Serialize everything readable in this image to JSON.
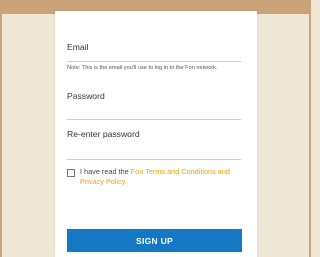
{
  "form": {
    "email_label": "Email",
    "email_note": "Note: This is the email you'll use to log in to the Fon network.",
    "password_label": "Password",
    "reenter_password_label": "Re-enter password",
    "terms_prefix": "I have read the ",
    "terms_link": "Fon Terms and Conditions and Privacy Policy.",
    "terms_checked": false,
    "signup_label": "SIGN UP"
  },
  "colors": {
    "background": "#efe6d6",
    "frame": "#caa478",
    "button": "#1478c5",
    "link": "#f2a007"
  }
}
